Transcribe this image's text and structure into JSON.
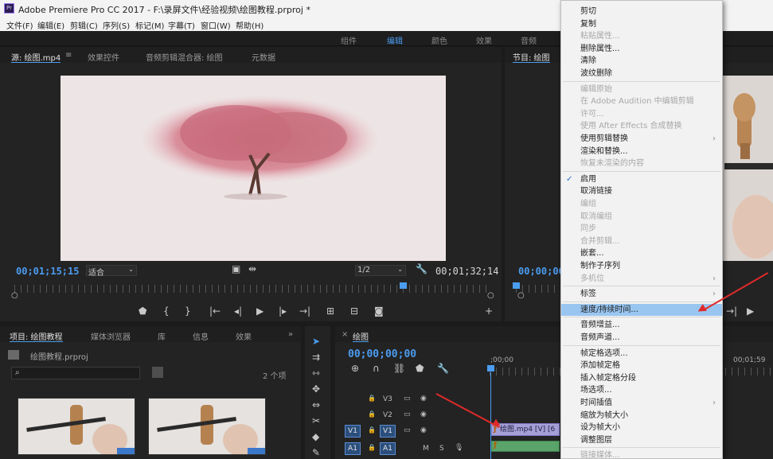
{
  "window": {
    "title": "Adobe Premiere Pro CC 2017 - F:\\录屏文件\\经验视频\\绘图教程.prproj *",
    "logo_text": "Pr"
  },
  "menubar": [
    "文件(F)",
    "编辑(E)",
    "剪辑(C)",
    "序列(S)",
    "标记(M)",
    "字幕(T)",
    "窗口(W)",
    "帮助(H)"
  ],
  "workspaces": [
    {
      "label": "组件",
      "active": false
    },
    {
      "label": "编辑",
      "active": true
    },
    {
      "label": "颜色",
      "active": false
    },
    {
      "label": "效果",
      "active": false
    },
    {
      "label": "音频",
      "active": false
    }
  ],
  "source": {
    "tabs": [
      "源: 绘图.mp4",
      "效果控件",
      "音频剪辑混合器: 绘图",
      "元数据"
    ],
    "timecode_in": "00;01;15;15",
    "fit": "适合",
    "resolution": "1/2",
    "duration": "00;01;32;14"
  },
  "program": {
    "tab": "节目: 绘图",
    "timecode": "00;00;00"
  },
  "project": {
    "tabs": [
      "项目: 绘图教程",
      "媒体浏览器",
      "库",
      "信息",
      "效果"
    ],
    "file": "绘图教程.prproj",
    "item_count": "2 个项",
    "expand": "»"
  },
  "timeline": {
    "tab": "绘图",
    "timecode": "00;00;00;00",
    "ruler_start": ";00;00",
    "ruler_end": "00;01;59",
    "tracks": [
      {
        "name": "V3",
        "source": "",
        "row": "video"
      },
      {
        "name": "V2",
        "source": "",
        "row": "video"
      },
      {
        "name": "V1",
        "source": "V1",
        "row": "video"
      },
      {
        "name": "A1",
        "source": "A1",
        "row": "audio"
      }
    ],
    "clip_label": "绘图.mp4 [V] [6",
    "audio_m": "M",
    "audio_s": "S"
  },
  "context_menu": {
    "items": [
      {
        "label": "剪切",
        "enabled": true
      },
      {
        "label": "复制",
        "enabled": true
      },
      {
        "label": "粘贴属性...",
        "enabled": false
      },
      {
        "label": "删除属性...",
        "enabled": true
      },
      {
        "label": "清除",
        "enabled": true
      },
      {
        "label": "波纹删除",
        "enabled": true
      },
      {
        "sep": true
      },
      {
        "label": "编辑原始",
        "enabled": false
      },
      {
        "label": "在 Adobe Audition 中编辑剪辑",
        "enabled": false
      },
      {
        "label": "许可...",
        "enabled": false
      },
      {
        "label": "使用 After Effects 合成替换",
        "enabled": false
      },
      {
        "label": "使用剪辑替换",
        "enabled": true,
        "submenu": true
      },
      {
        "label": "渲染和替换...",
        "enabled": true
      },
      {
        "label": "恢复未渲染的内容",
        "enabled": false
      },
      {
        "sep": true
      },
      {
        "label": "启用",
        "enabled": true,
        "checked": true
      },
      {
        "label": "取消链接",
        "enabled": true
      },
      {
        "label": "编组",
        "enabled": false
      },
      {
        "label": "取消编组",
        "enabled": false
      },
      {
        "label": "同步",
        "enabled": false
      },
      {
        "label": "合并剪辑...",
        "enabled": false
      },
      {
        "label": "嵌套...",
        "enabled": true
      },
      {
        "label": "制作子序列",
        "enabled": true
      },
      {
        "label": "多机位",
        "enabled": false,
        "submenu": true
      },
      {
        "sep": true
      },
      {
        "label": "标签",
        "enabled": true,
        "submenu": true
      },
      {
        "sep": true
      },
      {
        "label": "速度/持续时间...",
        "enabled": true,
        "highlighted": true
      },
      {
        "sep": true
      },
      {
        "label": "音频增益...",
        "enabled": true
      },
      {
        "label": "音频声道...",
        "enabled": true
      },
      {
        "sep": true
      },
      {
        "label": "帧定格选项...",
        "enabled": true
      },
      {
        "label": "添加帧定格",
        "enabled": true
      },
      {
        "label": "插入帧定格分段",
        "enabled": true
      },
      {
        "label": "场选项...",
        "enabled": true
      },
      {
        "label": "时间插值",
        "enabled": true,
        "submenu": true
      },
      {
        "label": "缩放为帧大小",
        "enabled": true
      },
      {
        "label": "设为帧大小",
        "enabled": true
      },
      {
        "label": "调整图层",
        "enabled": true
      },
      {
        "sep": true
      },
      {
        "label": "链接媒体...",
        "enabled": false
      }
    ]
  },
  "colors": {
    "accent": "#4a9df0",
    "highlight": "#99c6f1",
    "annotation_arrow": "#e02a2a"
  }
}
